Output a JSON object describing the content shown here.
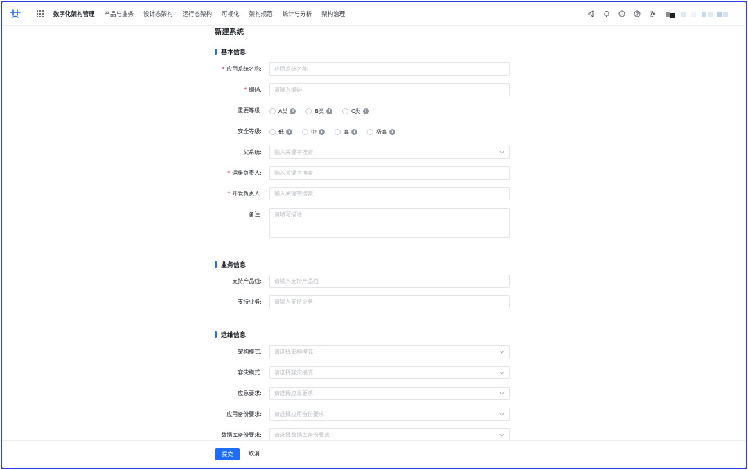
{
  "topnav": {
    "items": [
      "数字化架构管理",
      "产品与业务",
      "设计态架构",
      "运行态架构",
      "可视化",
      "架构规范",
      "统计与分析",
      "架构治理"
    ]
  },
  "page": {
    "title": "新建系统"
  },
  "sections": {
    "basic": "基本信息",
    "business": "业务信息",
    "ops": "运维信息"
  },
  "form": {
    "app_name": {
      "label": "应用系统名称:",
      "placeholder": "应用系统名称"
    },
    "code": {
      "label": "编码:",
      "placeholder": "请输入编码"
    },
    "importance": {
      "label": "重要等级:",
      "options": [
        "A类",
        "B类",
        "C类"
      ]
    },
    "security": {
      "label": "安全等级:",
      "options": [
        "低",
        "中",
        "高",
        "极高"
      ]
    },
    "parent": {
      "label": "父系统:",
      "placeholder": "输入关键字搜索"
    },
    "ops_owner": {
      "label": "运维负责人:",
      "placeholder": "输入关键字搜索"
    },
    "dev_owner": {
      "label": "开发负责人:",
      "placeholder": "输入关键字搜索"
    },
    "remark": {
      "label": "备注:",
      "placeholder": "请填写描述"
    },
    "product_line": {
      "label": "支持产品线:",
      "placeholder": "请输入支持产品线"
    },
    "business": {
      "label": "支持业务:",
      "placeholder": "请输入支持业务"
    },
    "arch_mode": {
      "label": "架构模式:",
      "placeholder": "请选择架构模式"
    },
    "dr_mode": {
      "label": "容灾模式:",
      "placeholder": "请选择容灾模式"
    },
    "emergency": {
      "label": "应急要求:",
      "placeholder": "请选择应急要求"
    },
    "app_backup": {
      "label": "应用备份要求:",
      "placeholder": "请选择应用备份要求"
    },
    "db_backup": {
      "label": "数据库备份要求:",
      "placeholder": "请选择数据库备份要求"
    }
  },
  "footer": {
    "submit": "提交",
    "cancel": "取消"
  },
  "info_glyph": "i",
  "required_mark": "*",
  "colors": {
    "accent": "#1e6fff",
    "required": "#f5222d"
  }
}
